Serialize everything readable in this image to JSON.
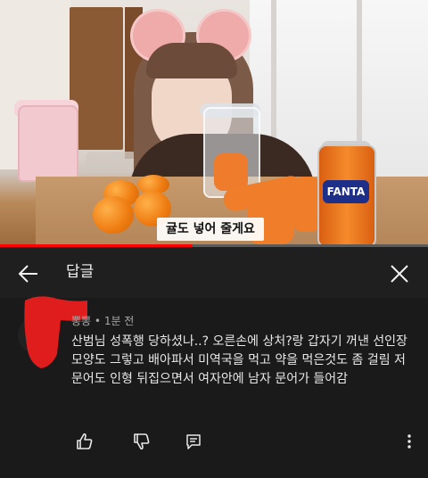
{
  "video": {
    "caption": "귤도 넣어 줄게요",
    "can_label": "FANTA",
    "progress": 0.45,
    "accent_color": "#ff0000"
  },
  "header": {
    "title": "답글",
    "back_icon": "arrow-left-icon",
    "close_icon": "close-icon"
  },
  "comment": {
    "author": "뽕뽕",
    "separator": " • ",
    "time": "1분 전",
    "text": "산범님 성폭행 당하셨나..? 오른손에 상처?랑 갑자기 꺼낸 선인장 모양도 그렇고 배아파서 미역국을 먹고 약을 먹은것도 좀 걸림 저 문어도 인형 뒤집으면서 여자안에 남자 문어가 들어감",
    "actions": [
      "like-icon",
      "dislike-icon",
      "reply-icon",
      "more-icon"
    ]
  }
}
